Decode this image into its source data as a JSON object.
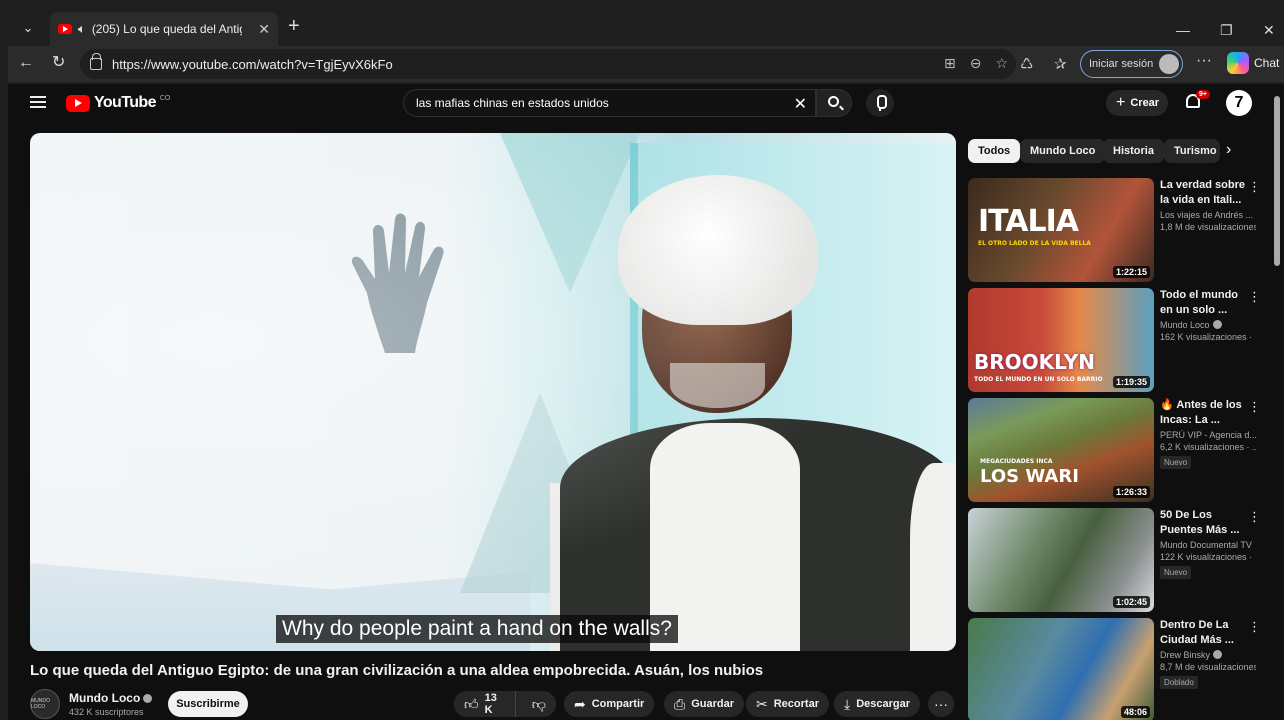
{
  "browser": {
    "tab_title": "(205) Lo que queda del Antig...",
    "tab_close": "✕",
    "new_tab": "+",
    "url": "https://www.youtube.com/watch?v=TgjEyvX6kFo",
    "signin_label": "Iniciar sesión",
    "chat_label": "Chat"
  },
  "youtube": {
    "logo_text": "YouTube",
    "logo_country": "CO",
    "search_value": "las mafias chinas en estados unidos",
    "create_label": "Crear",
    "notif_badge": "9+",
    "avatar_letter": "7"
  },
  "video": {
    "subtitle": "Why do people paint a hand on the walls?",
    "title": "Lo que queda del Antiguo Egipto: de una gran civilización a una aldea empobrecida. Asuán, los nubios",
    "channel_name": "Mundo Loco",
    "channel_avatar_text": "MUNDO LOCO",
    "subscribers": "432 K suscriptores",
    "subscribe_label": "Suscribirme",
    "likes": "13 K",
    "share_label": "Compartir",
    "save_label": "Guardar",
    "clip_label": "Recortar",
    "download_label": "Descargar"
  },
  "chips": [
    "Todos",
    "Mundo Loco",
    "Historia",
    "Turismo"
  ],
  "recommendations": [
    {
      "title1": "La verdad sobre",
      "title2": "la vida en Itali...",
      "channel": "Los viajes de Andrés ...",
      "views": "1,8 M de visualizaciones",
      "duration": "1:22:15",
      "thumb_text": "ITALIA",
      "thumb_sub": "EL OTRO LADO DE LA VIDA BELLA",
      "badge": ""
    },
    {
      "title1": "Todo el mundo",
      "title2": "en un solo ...",
      "channel": "Mundo Loco",
      "views": "162 K visualizaciones ·",
      "duration": "1:19:35",
      "thumb_text": "BROOKLYN",
      "thumb_sub": "TODO EL MUNDO EN UN SOLO BARRIO",
      "badge": ""
    },
    {
      "title1": "🔥 Antes de los",
      "title2": "Incas: La ...",
      "channel": "PERÚ VIP - Agencia d...",
      "views": "6,2 K visualizaciones · ...",
      "duration": "1:26:33",
      "thumb_text": "LOS WARI",
      "thumb_sub": "MEGACIUDADES INCA",
      "badge": "Nuevo"
    },
    {
      "title1": "50 De Los",
      "title2": "Puentes Más ...",
      "channel": "Mundo Documental TV",
      "views": "122 K visualizaciones ·",
      "duration": "1:02:45",
      "thumb_text": "",
      "thumb_sub": "",
      "badge": "Nuevo"
    },
    {
      "title1": "Dentro De La",
      "title2": "Ciudad Más ...",
      "channel": "Drew Binsky",
      "views": "8,7 M de visualizaciones",
      "duration": "48:06",
      "thumb_text": "",
      "thumb_sub": "",
      "badge": "Doblado"
    }
  ]
}
